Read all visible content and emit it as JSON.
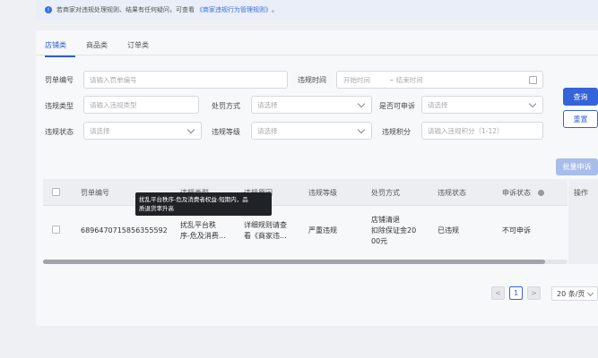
{
  "notice": {
    "text": "若商家对违规处理规则、结果有任何疑问，可查看",
    "link": "《商家违规行为管理规则》",
    "suffix": "。"
  },
  "tabs": [
    {
      "label": "店铺类",
      "active": true
    },
    {
      "label": "商品类",
      "active": false
    },
    {
      "label": "订单类",
      "active": false
    }
  ],
  "filters": {
    "penalty_no": {
      "label": "罚单编号",
      "placeholder": "请输入罚单编号"
    },
    "violation_time": {
      "label": "违规时间",
      "start": "开始时间",
      "sep": "–",
      "end": "结束时间"
    },
    "violation_type": {
      "label": "违规类型",
      "placeholder": "请输入违规类型"
    },
    "penalty_method": {
      "label": "处罚方式",
      "placeholder": "请选择"
    },
    "appealable": {
      "label": "是否可申诉",
      "placeholder": "请选择"
    },
    "violation_status": {
      "label": "违规状态",
      "placeholder": "请选择"
    },
    "violation_level": {
      "label": "违规等级",
      "placeholder": "请选择"
    },
    "violation_points": {
      "label": "违规积分",
      "placeholder": "请输入违规积分（1-12）"
    }
  },
  "buttons": {
    "query": "查询",
    "reset": "重置",
    "batch_appeal": "批量申诉"
  },
  "table": {
    "headers": {
      "penalty_no": "罚单编号",
      "violation_type": "违规类型",
      "violation_reason": "违规原因",
      "violation_level": "违规等级",
      "penalty_method": "处罚方式",
      "violation_status": "违规状态",
      "appeal_status": "申诉状态",
      "operation": "操作"
    },
    "rows": [
      {
        "penalty_no": "6896470715856355592",
        "violation_type_l1": "扰乱平台秩",
        "violation_type_l2": "序-危及消费...",
        "violation_reason_l1": "详细规则请查",
        "violation_reason_l2": "看《商家违...",
        "violation_level": "严重违规",
        "penalty_l1": "店铺清退",
        "penalty_l2": "扣除保证金20",
        "penalty_l3": "00元",
        "violation_status": "已违规",
        "appeal_status": "不可申诉"
      }
    ]
  },
  "tooltip": {
    "line1": "扰乱平台秩序-危及消费者权益-短期内，品",
    "line2": "质退货率升高"
  },
  "pagination": {
    "prev": "<",
    "current": "1",
    "next": ">",
    "page_size": "20 条/页"
  }
}
